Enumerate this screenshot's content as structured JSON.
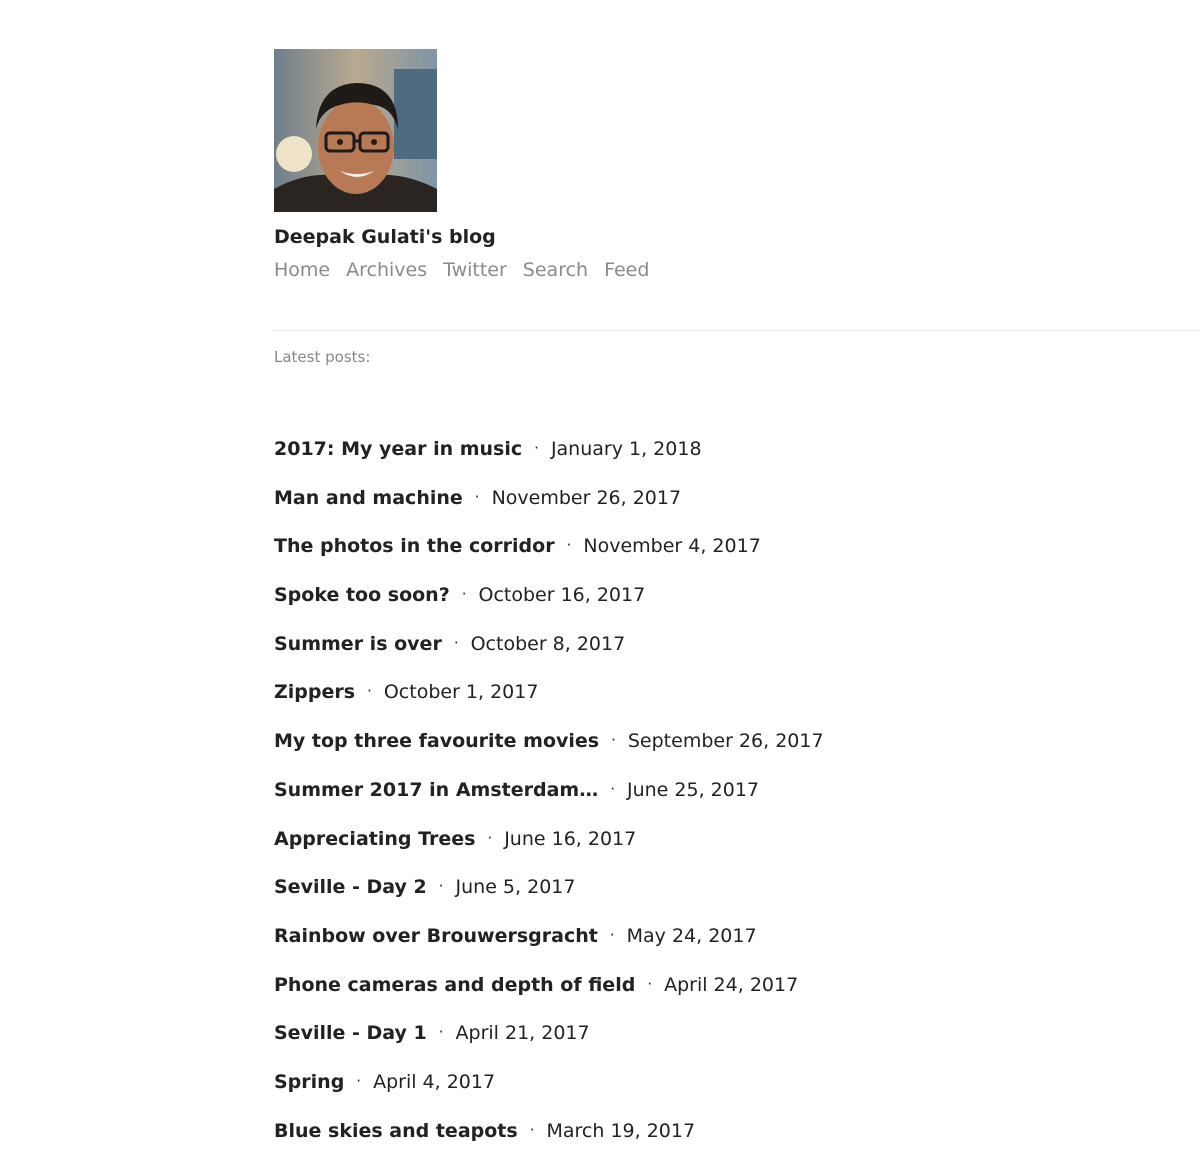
{
  "header": {
    "avatar_icon": "portrait-photo",
    "blog_title": "Deepak Gulati's blog"
  },
  "nav": {
    "home": "Home",
    "archives": "Archives",
    "twitter": "Twitter",
    "search": "Search",
    "feed": "Feed"
  },
  "main": {
    "latest_label": "Latest posts:",
    "separator": "·",
    "posts": [
      {
        "title": "2017: My year in music",
        "date": "January 1, 2018"
      },
      {
        "title": "Man and machine",
        "date": "November 26, 2017"
      },
      {
        "title": "The photos in the corridor",
        "date": "November 4, 2017"
      },
      {
        "title": "Spoke too soon?",
        "date": "October 16, 2017"
      },
      {
        "title": "Summer is over",
        "date": "October 8, 2017"
      },
      {
        "title": "Zippers",
        "date": "October 1, 2017"
      },
      {
        "title": "My top three favourite movies",
        "date": "September 26, 2017"
      },
      {
        "title": "Summer 2017 in Amsterdam…",
        "date": "June 25, 2017"
      },
      {
        "title": "Appreciating Trees",
        "date": "June 16, 2017"
      },
      {
        "title": "Seville - Day 2",
        "date": "June 5, 2017"
      },
      {
        "title": "Rainbow over Brouwersgracht",
        "date": "May 24, 2017"
      },
      {
        "title": "Phone cameras and depth of field",
        "date": "April 24, 2017"
      },
      {
        "title": "Seville - Day 1",
        "date": "April 21, 2017"
      },
      {
        "title": "Spring",
        "date": "April 4, 2017"
      },
      {
        "title": "Blue skies and teapots",
        "date": "March 19, 2017"
      }
    ]
  },
  "colors": {
    "text": "#222222",
    "muted": "#8a8a8a",
    "divider": "#e6e6e6"
  }
}
